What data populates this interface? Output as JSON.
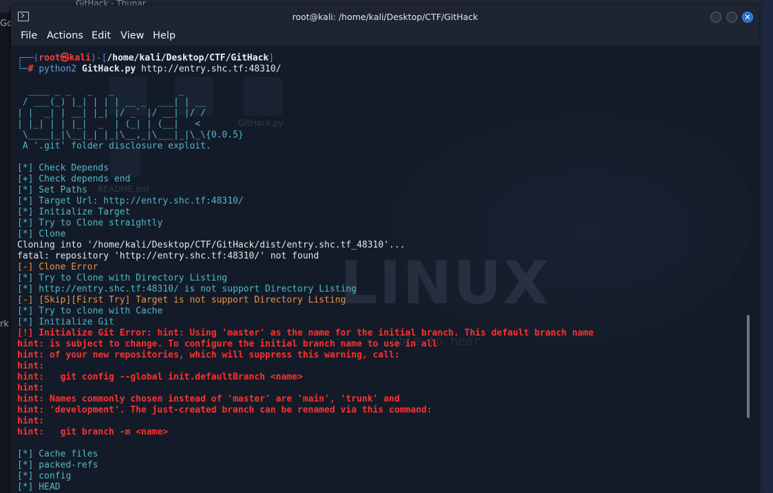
{
  "background": {
    "thunar_title": "GitHack - Thunar",
    "left_fragments": [
      {
        "text": "Go"
      },
      {
        "text": "rk"
      }
    ]
  },
  "window": {
    "title": "root@kali: /home/kali/Desktop/CTF/GitHack",
    "close_glyph": "✕"
  },
  "menu": [
    "File",
    "Actions",
    "Edit",
    "View",
    "Help"
  ],
  "wallpaper": {
    "icons": [
      "GitHack.py",
      "README.md"
    ],
    "big_text": "LINUX",
    "tagline": "able to hear"
  },
  "prompt": {
    "open": "┌──(",
    "user": "root㉿kali",
    "mid": ")-[",
    "path": "/home/kali/Desktop/CTF/GitHack",
    "close": "]",
    "prefix2": "└─",
    "hash": "#",
    "cmd_program": "python2",
    "cmd_script": "GitHack.py",
    "cmd_arg": "http://entry.shc.tf:48310/"
  },
  "banner": [
    "  ____ _ _   _   _            _",
    " / ___(_) |_| | | | __ _  ___| | __",
    "| |  _| | __| |_| |/ _` |/ __| |/ /",
    "| |_| | | |_|  _  | (_| | (__|   <",
    " \\____|_|\\__|_| |_|\\__,_|\\___|_|\\_\\{0.0.5}",
    " A '.git' folder disclosure exploit."
  ],
  "log": [
    {
      "text": "[*] Check Depends",
      "style": "teal"
    },
    {
      "text": "[+] Check depends end",
      "style": "teal"
    },
    {
      "text": "[*] Set Paths",
      "style": "teal"
    },
    {
      "text": "[*] Target Url: http://entry.shc.tf:48310/",
      "style": "teal"
    },
    {
      "text": "[*] Initialize Target",
      "style": "teal"
    },
    {
      "text": "[*] Try to Clone straightly",
      "style": "teal"
    },
    {
      "text": "[*] Clone",
      "style": "teal"
    },
    {
      "text": "Cloning into '/home/kali/Desktop/CTF/GitHack/dist/entry.shc.tf_48310'...",
      "style": "white"
    },
    {
      "text": "fatal: repository 'http://entry.shc.tf:48310/' not found",
      "style": "white"
    },
    {
      "text": "[-] Clone Error",
      "style": "orange"
    },
    {
      "text": "[*] Try to Clone with Directory Listing",
      "style": "teal"
    },
    {
      "text": "[*] http://entry.shc.tf:48310/ is not support Directory Listing",
      "style": "teal"
    },
    {
      "text": "[-] [Skip][First Try] Target is not support Directory Listing",
      "style": "orange"
    },
    {
      "text": "[*] Try to clone with Cache",
      "style": "teal"
    },
    {
      "text": "[*] Initialize Git",
      "style": "teal"
    },
    {
      "text": "[!] Initialize Git Error: hint: Using 'master' as the name for the initial branch. This default branch name",
      "style": "red"
    },
    {
      "text": "hint: is subject to change. To configure the initial branch name to use in all",
      "style": "red"
    },
    {
      "text": "hint: of your new repositories, which will suppress this warning, call:",
      "style": "red"
    },
    {
      "text": "hint:",
      "style": "red"
    },
    {
      "text": "hint:   git config --global init.defaultBranch <name>",
      "style": "red"
    },
    {
      "text": "hint:",
      "style": "red"
    },
    {
      "text": "hint: Names commonly chosen instead of 'master' are 'main', 'trunk' and",
      "style": "red"
    },
    {
      "text": "hint: 'development'. The just-created branch can be renamed via this command:",
      "style": "red"
    },
    {
      "text": "hint:",
      "style": "red"
    },
    {
      "text": "hint:   git branch -m <name>",
      "style": "red"
    },
    {
      "text": "",
      "style": "white"
    },
    {
      "text": "[*] Cache files",
      "style": "teal"
    },
    {
      "text": "[*] packed-refs",
      "style": "teal"
    },
    {
      "text": "[*] config",
      "style": "teal"
    },
    {
      "text": "[*] HEAD",
      "style": "teal"
    }
  ]
}
